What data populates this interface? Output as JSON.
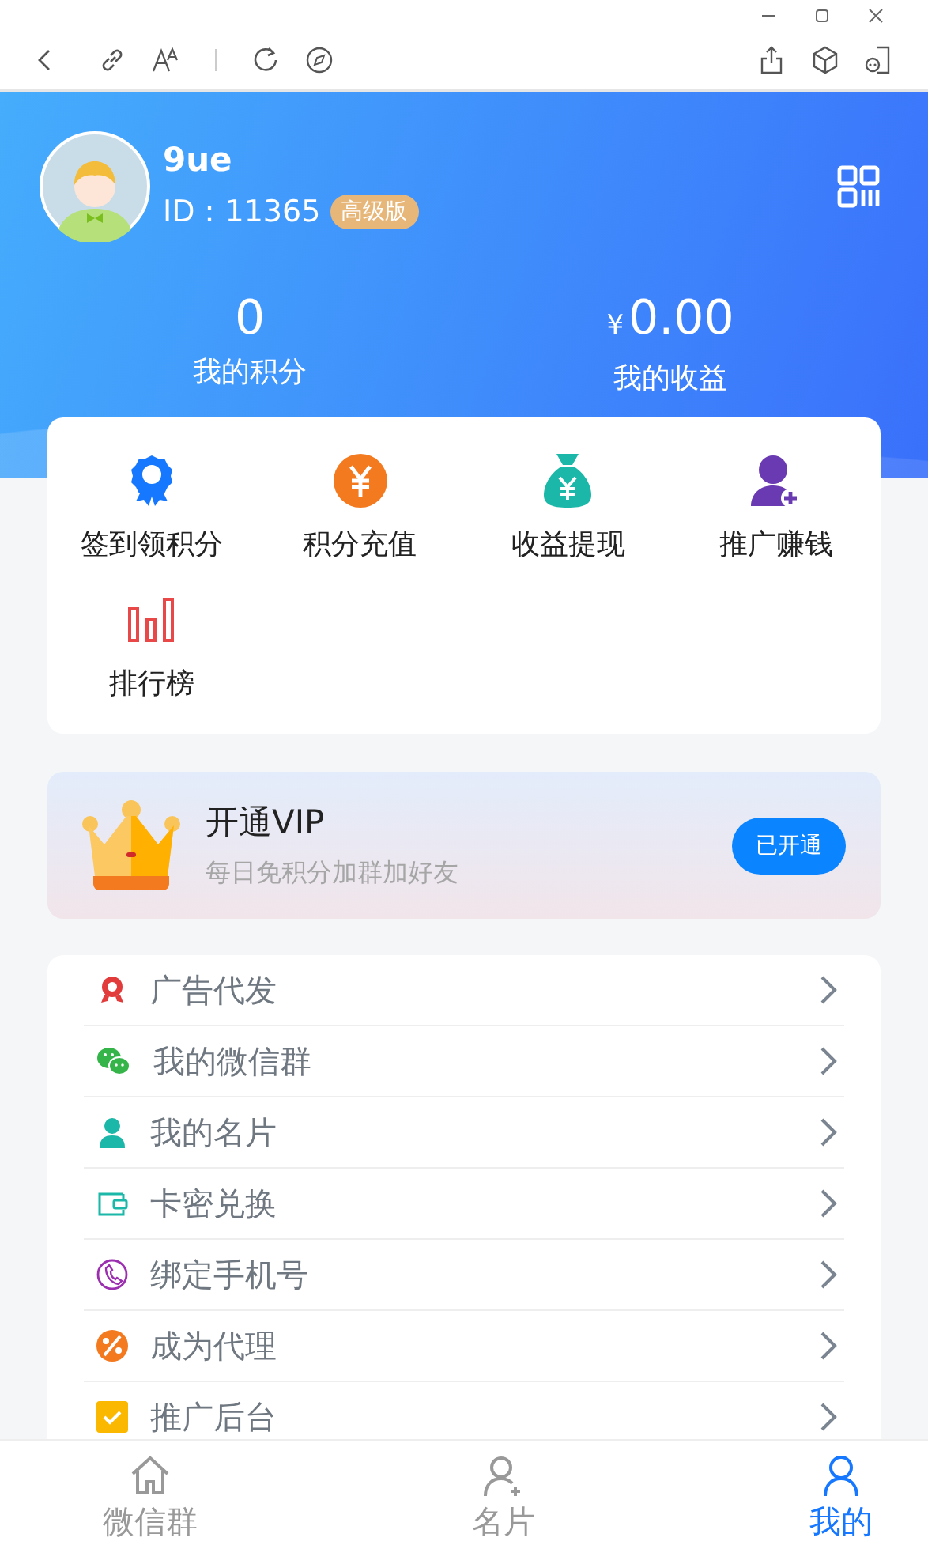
{
  "profile": {
    "name": "9ue",
    "id_label": "ID：",
    "id": "11365",
    "badge": "高级版"
  },
  "stats": [
    {
      "value": "0",
      "label": "我的积分"
    },
    {
      "value": "0.00",
      "currency": "¥",
      "label": "我的收益"
    }
  ],
  "actions": [
    {
      "kind": "badge",
      "label": "签到领积分"
    },
    {
      "kind": "coin",
      "label": "积分充值"
    },
    {
      "kind": "bag",
      "label": "收益提现"
    },
    {
      "kind": "adduser",
      "label": "推广赚钱"
    },
    {
      "kind": "bars",
      "label": "排行榜"
    }
  ],
  "vip": {
    "title": "开通VIP",
    "subtitle": "每日免积分加群加好友",
    "button": "已开通"
  },
  "menu": [
    {
      "kind": "ribbon",
      "label": "广告代发"
    },
    {
      "kind": "wechat",
      "label": "我的微信群"
    },
    {
      "kind": "person",
      "label": "我的名片"
    },
    {
      "kind": "wallet",
      "label": "卡密兑换"
    },
    {
      "kind": "phone",
      "label": "绑定手机号"
    },
    {
      "kind": "percent",
      "label": "成为代理"
    },
    {
      "kind": "check",
      "label": "推广后台"
    }
  ],
  "tabs": [
    {
      "kind": "home",
      "label": "微信群",
      "selected": false
    },
    {
      "kind": "adduser",
      "label": "名片",
      "selected": false
    },
    {
      "kind": "user",
      "label": "我的",
      "selected": true
    }
  ]
}
